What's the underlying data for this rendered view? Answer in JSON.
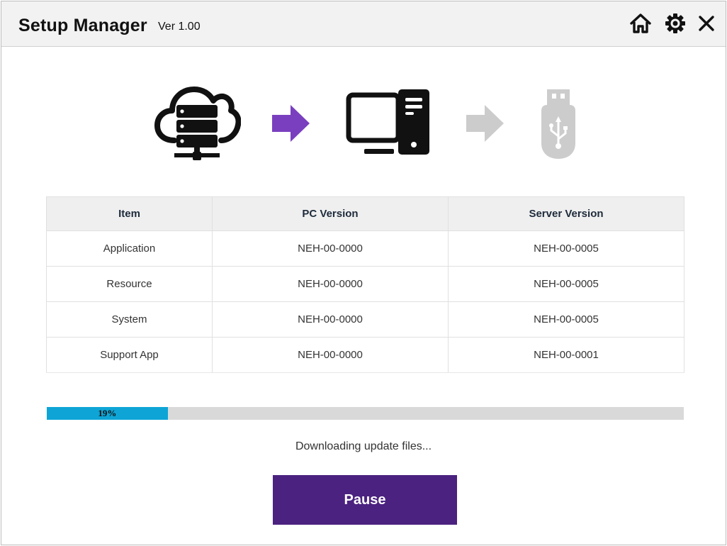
{
  "app": {
    "title": "Setup Manager",
    "version": "Ver 1.00"
  },
  "toolbar": {
    "home_icon": "home-icon",
    "settings_icon": "gear-icon",
    "close_icon": "close-icon"
  },
  "flow": {
    "source_icon": "cloud-server-icon",
    "target_icon": "desktop-computer-icon",
    "device_icon": "usb-drive-icon",
    "active_arrow_color": "#7a3fbf",
    "inactive_arrow_color": "#cccccc"
  },
  "table": {
    "headers": [
      "Item",
      "PC Version",
      "Server Version"
    ],
    "rows": [
      [
        "Application",
        "NEH-00-0000",
        "NEH-00-0005"
      ],
      [
        "Resource",
        "NEH-00-0000",
        "NEH-00-0005"
      ],
      [
        "System",
        "NEH-00-0000",
        "NEH-00-0005"
      ],
      [
        "Support App",
        "NEH-00-0000",
        "NEH-00-0001"
      ]
    ]
  },
  "progress": {
    "percent": 19,
    "label": "19%",
    "fill_color": "#0ea5d6"
  },
  "status": {
    "message": "Downloading update files..."
  },
  "actions": {
    "pause_label": "Pause",
    "button_color": "#4b2280"
  }
}
